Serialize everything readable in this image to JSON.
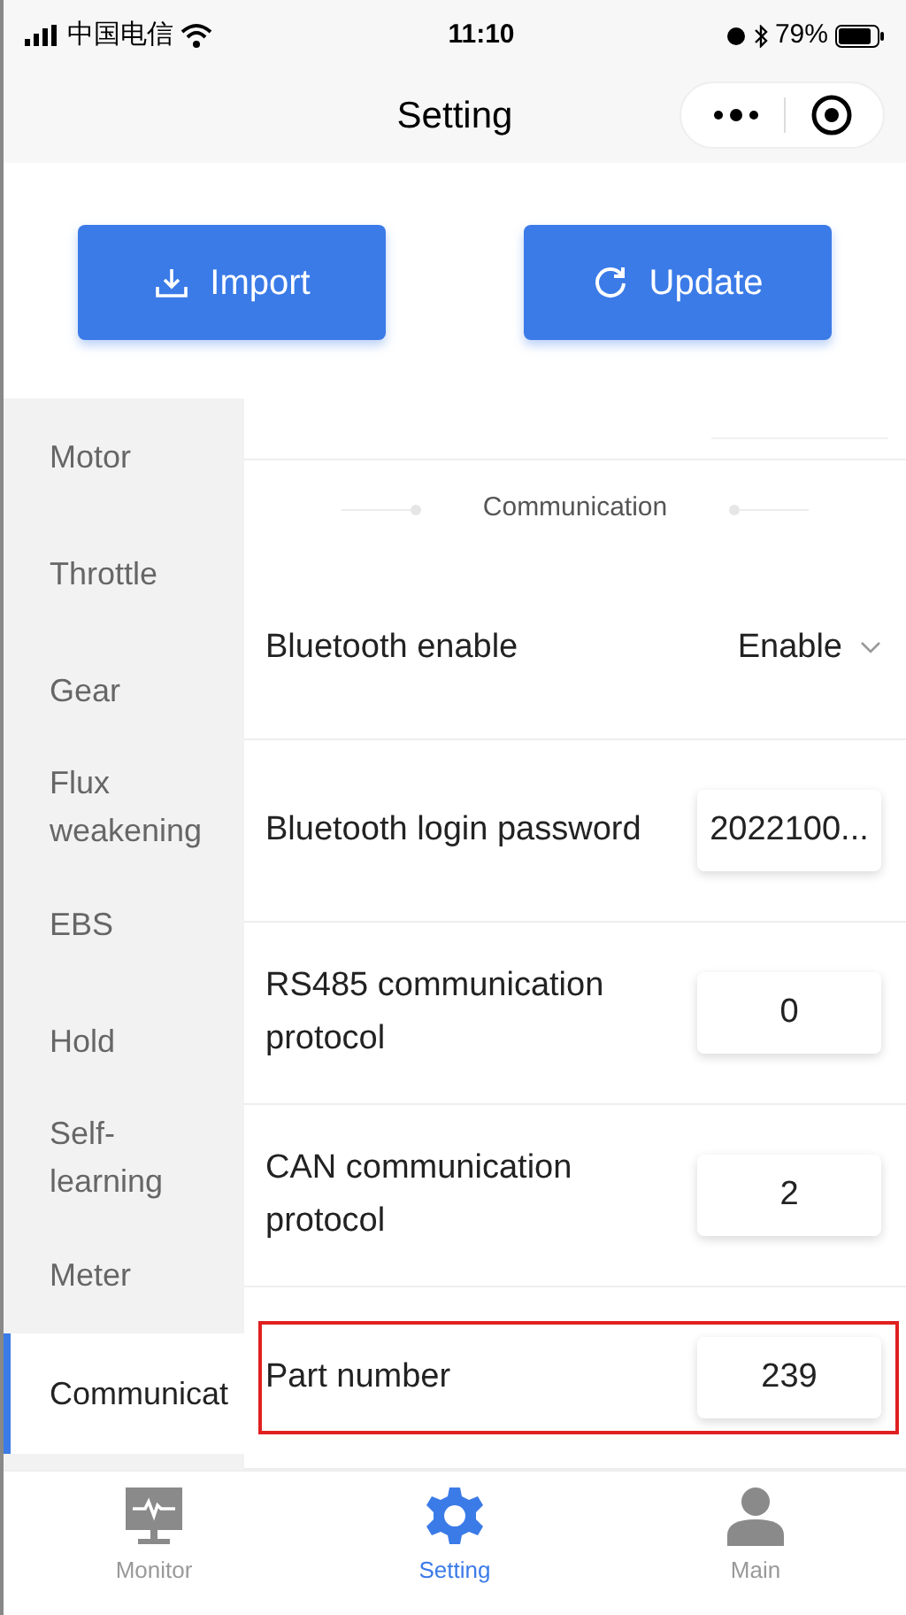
{
  "status_bar": {
    "carrier": "中国电信",
    "time": "11:10",
    "battery": "79%"
  },
  "nav_bar": {
    "title": "Setting"
  },
  "actions": [
    {
      "label": "Import",
      "kind": "import"
    },
    {
      "label": "Update",
      "kind": "update"
    }
  ],
  "sidebar": {
    "items": [
      {
        "label": "Motor",
        "selected": false
      },
      {
        "label": "Throttle",
        "selected": false
      },
      {
        "label": "Gear",
        "selected": false
      },
      {
        "label": "Flux weakening",
        "selected": false
      },
      {
        "label": "EBS",
        "selected": false
      },
      {
        "label": "Hold",
        "selected": false
      },
      {
        "label": "Self-learning",
        "selected": false
      },
      {
        "label": "Meter",
        "selected": false
      },
      {
        "label": "Communicat",
        "selected": true
      }
    ]
  },
  "section_title": "Communication",
  "rows": [
    {
      "label": "Bluetooth enable",
      "kind": "select",
      "value": "Enable",
      "highlighted": false
    },
    {
      "label": "Bluetooth login password",
      "kind": "input",
      "value": "2022100...",
      "highlighted": false
    },
    {
      "label": "RS485 communication protocol",
      "kind": "input",
      "value": "0",
      "highlighted": false
    },
    {
      "label": "CAN communication protocol",
      "kind": "input",
      "value": "2",
      "highlighted": false
    },
    {
      "label": "Part number",
      "kind": "input",
      "value": "239",
      "highlighted": true
    }
  ],
  "tab_bar": [
    {
      "label": "Monitor",
      "kind": "monitor",
      "selected": false
    },
    {
      "label": "Setting",
      "kind": "setting",
      "selected": true
    },
    {
      "label": "Main",
      "kind": "main",
      "selected": false
    }
  ]
}
